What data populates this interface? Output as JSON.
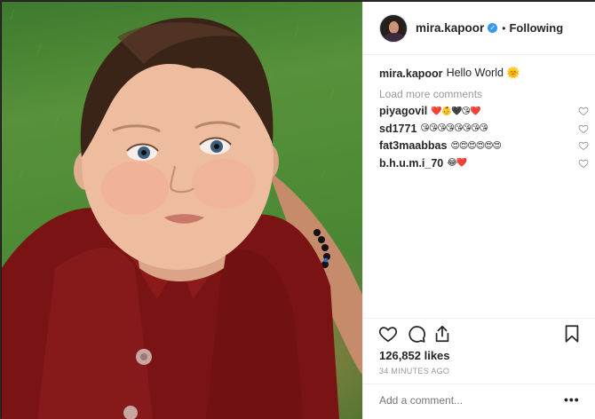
{
  "photo": {
    "description_icon": "baby-photo"
  },
  "post": {
    "username": "mira.kapoor",
    "verified_icon": "verified-badge-icon",
    "separator": "•",
    "follow_status": "Following",
    "caption_user": "mira.kapoor",
    "caption_text": "Hello World 🌞",
    "load_more": "Load more comments",
    "comments": [
      {
        "user": "piyagovil",
        "text": "❤️👶🖤😘❤️"
      },
      {
        "user": "sd1771",
        "text": "😘😘😘😘😘😘😘😘"
      },
      {
        "user": "fat3maabbas",
        "text": "😍😍😍😍😍😍"
      },
      {
        "user": "b.h.u.m.i_70",
        "text": "😂❤️"
      }
    ],
    "likes": "126,852 likes",
    "time": "34 MINUTES AGO",
    "add_comment_placeholder": "Add a comment...",
    "options": "•••"
  },
  "colors": {
    "accent": "#3897f0",
    "muted": "#999999",
    "text": "#262626",
    "border": "#efefef"
  }
}
